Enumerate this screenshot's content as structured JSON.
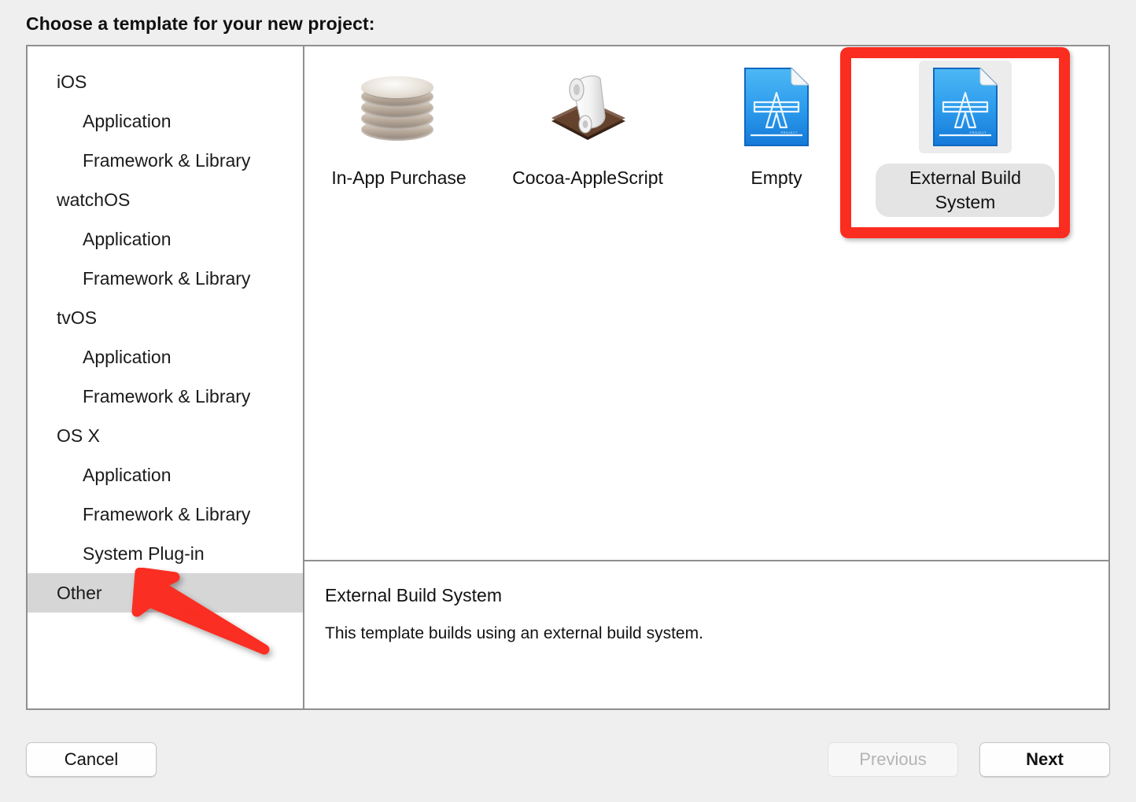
{
  "dialog": {
    "title": "Choose a template for your new project:"
  },
  "sidebar": {
    "items": [
      {
        "label": "iOS",
        "level": 0,
        "selected": false
      },
      {
        "label": "Application",
        "level": 1,
        "selected": false
      },
      {
        "label": "Framework & Library",
        "level": 1,
        "selected": false
      },
      {
        "label": "watchOS",
        "level": 0,
        "selected": false
      },
      {
        "label": "Application",
        "level": 1,
        "selected": false
      },
      {
        "label": "Framework & Library",
        "level": 1,
        "selected": false
      },
      {
        "label": "tvOS",
        "level": 0,
        "selected": false
      },
      {
        "label": "Application",
        "level": 1,
        "selected": false
      },
      {
        "label": "Framework & Library",
        "level": 1,
        "selected": false
      },
      {
        "label": "OS X",
        "level": 0,
        "selected": false
      },
      {
        "label": "Application",
        "level": 1,
        "selected": false
      },
      {
        "label": "Framework & Library",
        "level": 1,
        "selected": false
      },
      {
        "label": "System Plug-in",
        "level": 1,
        "selected": false
      },
      {
        "label": "Other",
        "level": 0,
        "selected": true
      }
    ]
  },
  "templates": [
    {
      "label": "In-App Purchase",
      "icon": "coin-stack-icon",
      "selected": false
    },
    {
      "label": "Cocoa-AppleScript",
      "icon": "applescript-scroll-icon",
      "selected": false
    },
    {
      "label": "Empty",
      "icon": "xcode-project-document-icon",
      "selected": false
    },
    {
      "label": "External Build System",
      "icon": "xcode-project-document-icon",
      "selected": true
    }
  ],
  "description": {
    "title": "External Build System",
    "body": "This template builds using an external build system."
  },
  "footer": {
    "cancel": "Cancel",
    "previous": "Previous",
    "next": "Next"
  },
  "annotations": {
    "highlight_color": "#fa2d20",
    "arrow_color": "#fa2d20",
    "arrow_target": "Other",
    "rect_target": "External Build System"
  }
}
